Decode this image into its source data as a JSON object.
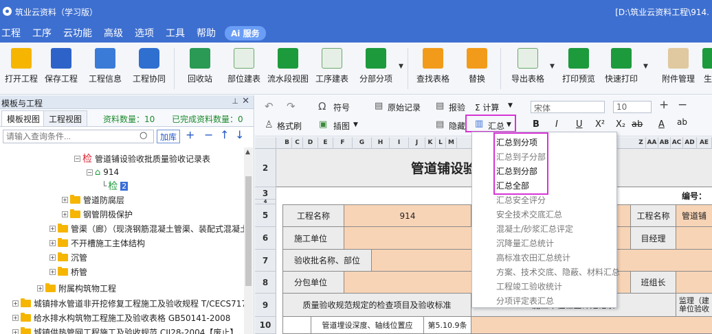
{
  "window": {
    "title": "筑业云资料（学习版）",
    "path": "[D:\\筑业云资料工程\\914."
  },
  "menu": {
    "items": [
      "工程",
      "工序",
      "云功能",
      "高级",
      "选项",
      "工具",
      "帮助"
    ],
    "ai": "Ai 服务"
  },
  "ribbon": {
    "open": "打开工程",
    "save": "保存工程",
    "info": "工程信息",
    "collab": "工程协同",
    "recycle": "回收站",
    "dept": "部位建表",
    "flow": "流水段视图",
    "proc": "工序建表",
    "split": "分部分项",
    "find": "查找表格",
    "replace": "替换",
    "export": "导出表格",
    "preview": "打印预览",
    "print": "快速打印",
    "attach": "附件管理",
    "more": "生"
  },
  "left": {
    "title": "模板与工程",
    "pin": "ᵖ",
    "close": "✕",
    "tab_template": "模板视图",
    "tab_project": "工程视图",
    "count": "资料数量：10",
    "done": "已完成资料数量：0",
    "search_placeholder": "请输入查询条件...",
    "lib": "加库",
    "tree": [
      "管道铺设验收批质量验收记录表",
      "914",
      "2",
      "管道防腐层",
      "钢管阴极保护",
      "管渠（廊）（现浇钢筋混凝土管渠、装配式混凝土",
      "不开槽施工主体结构",
      "沉管",
      "桥管",
      "附属构筑物工程",
      "城镇排水管道非开挖修复工程施工及验收规程 T/CECS717-",
      "给水排水构筑物工程施工及验收表格 GB50141-2008",
      "城镇供热管网工程施工及验收规范 CJJ28-2004【废止】"
    ],
    "jian": "检"
  },
  "editor": {
    "symbol": "符号",
    "orig": "原始记录",
    "report": "报验",
    "calc": "Σ 计算",
    "font": "宋体",
    "size": "10",
    "brush": "格式刷",
    "image": "插图",
    "hide": "隐藏",
    "summary": "汇总",
    "bold": "B",
    "italic": "I",
    "underline": "U",
    "sup": "X²",
    "sub": "X₂",
    "strike": "ab",
    "color": "A",
    "pinyin": "ab"
  },
  "sheet": {
    "cols": [
      "B",
      "C",
      "D",
      "E",
      "F",
      "G",
      "H",
      "I",
      "J",
      "K",
      "L",
      "M",
      "Z",
      "AA",
      "AB",
      "AC",
      "AD",
      "AE"
    ],
    "rows": [
      "2",
      "3",
      "4",
      "5",
      "6",
      "7",
      "8",
      "9",
      "10"
    ],
    "title": "管道铺设验",
    "serial": "编号：",
    "proj_name": "工程名称",
    "proj_val": "914",
    "unit": "施工单位",
    "batch": "验收批名称、部位",
    "sub": "分包单位",
    "r5_right": "工程名称",
    "r5_right2": "管道铺",
    "r6_right": "目经理",
    "r8_right": "班组长",
    "quality": "质量验收规范规定的检查项目及验收标准",
    "record": "施工单位检查评定记录",
    "supervise": "监理（建\n单位验收",
    "item": "管道埋设深度、轴线位置应",
    "clause": "第5.10.9条"
  },
  "dropdown": {
    "items": [
      "汇总到分项",
      "汇总到子分部",
      "汇总到分部",
      "汇总全部",
      "汇总安全评分",
      "安全技术交底汇总",
      "混凝土/砂浆汇总评定",
      "沉降量汇总统计",
      "高标准农田汇总统计",
      "方案、技术交底、隐蔽、材料汇总",
      "工程竣工验收统计",
      "分项评定表汇总"
    ]
  },
  "colors": {
    "titlebar": "#3d6fd0",
    "highlight": "#d633d6",
    "peach": "#f8d4b6"
  }
}
